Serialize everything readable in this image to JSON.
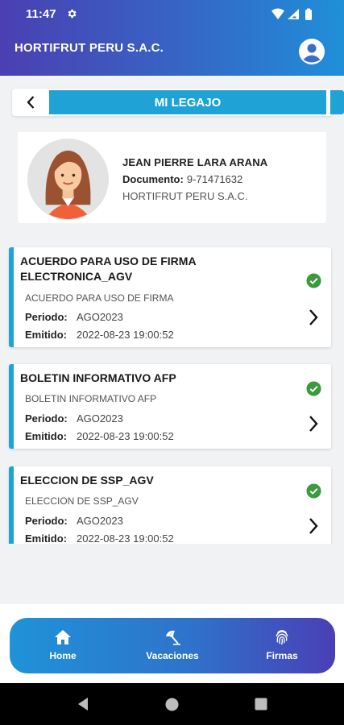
{
  "status": {
    "time": "11:47"
  },
  "app": {
    "title": "HORTIFRUT PERU S.A.C."
  },
  "page": {
    "title": "MI LEGAJO"
  },
  "profile": {
    "name": "JEAN PIERRE LARA ARANA",
    "doc_label": "Documento:",
    "doc_value": "9-71471632",
    "company": "HORTIFRUT PERU S.A.C."
  },
  "documents": [
    {
      "title": "ACUERDO PARA USO DE FIRMA ELECTRONICA_AGV",
      "subtitle": "ACUERDO PARA USO DE FIRMA",
      "period_label": "Periodo:",
      "period": "AGO2023",
      "issued_label": "Emitido:",
      "issued": "2022-08-23 19:00:52",
      "signed": true
    },
    {
      "title": "BOLETIN INFORMATIVO AFP",
      "subtitle": "BOLETIN INFORMATIVO AFP",
      "period_label": "Periodo:",
      "period": "AGO2023",
      "issued_label": "Emitido:",
      "issued": "2022-08-23 19:00:52",
      "signed": true
    },
    {
      "title": "ELECCION DE SSP_AGV",
      "subtitle": "ELECCION DE SSP_AGV",
      "period_label": "Periodo:",
      "period": "AGO2023",
      "issued_label": "Emitido:",
      "issued": "2022-08-23 19:00:52",
      "signed": true
    }
  ],
  "nav": {
    "home": "Home",
    "vacations": "Vacaciones",
    "signatures": "Firmas"
  },
  "colors": {
    "accent": "#1fa3d6",
    "header_start": "#4b3fb3",
    "header_end": "#1f8fd8",
    "check": "#3a9a3e"
  }
}
